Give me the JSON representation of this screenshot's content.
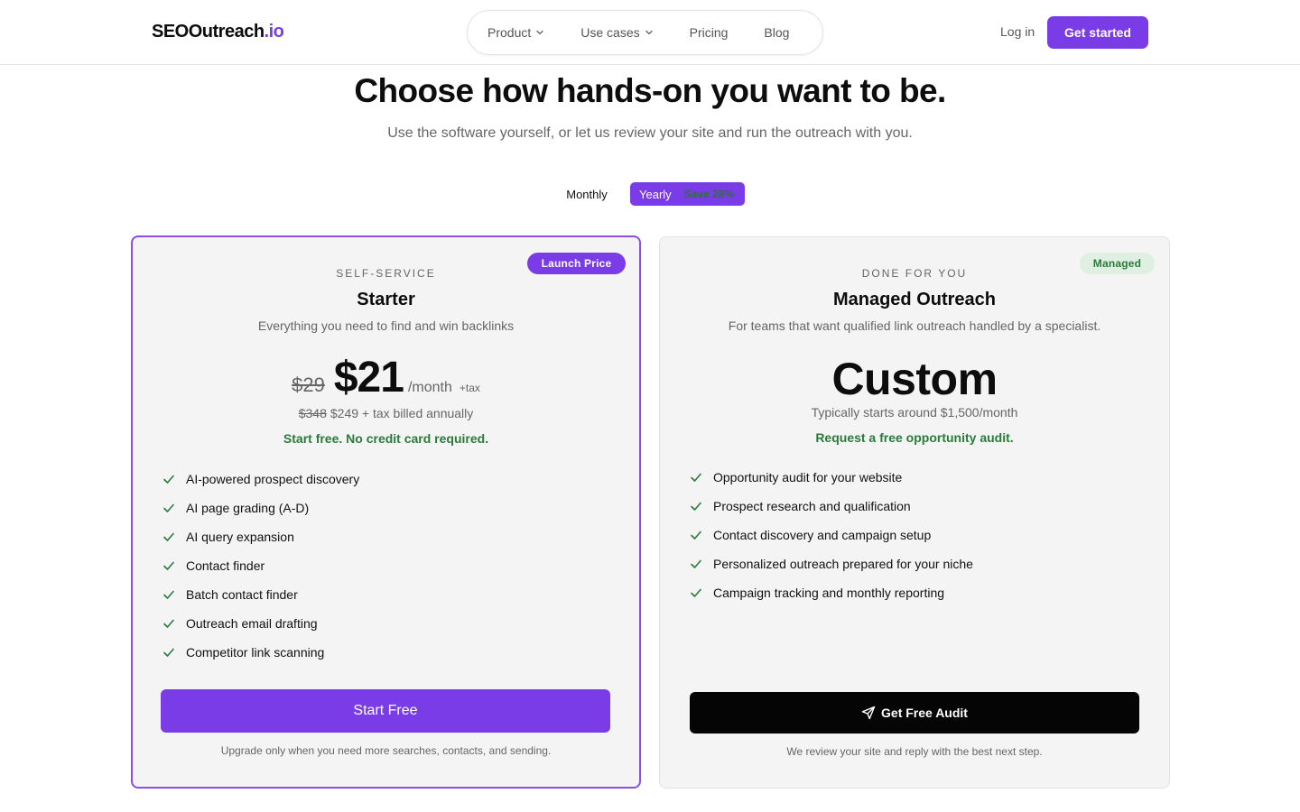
{
  "brand": {
    "name": "SEOOutreach",
    "tld": ".io"
  },
  "nav": {
    "items": [
      {
        "label": "Product",
        "dropdown": true
      },
      {
        "label": "Use cases",
        "dropdown": true
      },
      {
        "label": "Pricing",
        "dropdown": false
      },
      {
        "label": "Blog",
        "dropdown": false
      }
    ],
    "login": "Log in",
    "cta": "Get started"
  },
  "hero": {
    "title": "Choose how hands-on you want to be.",
    "subtitle": "Use the software yourself, or let us review your site and run the outreach with you."
  },
  "billing_toggle": {
    "monthly": "Monthly",
    "yearly": "Yearly",
    "save": "Save 28%",
    "selected": "Yearly"
  },
  "plans": {
    "starter": {
      "badge": "Launch Price",
      "eyebrow": "SELF-SERVICE",
      "name": "Starter",
      "description": "Everything you need to find and win backlinks",
      "old_price": "$29",
      "price": "$21",
      "per": "/month",
      "tax": "+tax",
      "annual_old": "$348",
      "annual": "$249 + tax billed annually",
      "note": "Start free. No credit card required.",
      "features": [
        "AI-powered prospect discovery",
        "AI page grading (A-D)",
        "AI query expansion",
        "Contact finder",
        "Batch contact finder",
        "Outreach email drafting",
        "Competitor link scanning"
      ],
      "cta": "Start Free",
      "footnote": "Upgrade only when you need more searches, contacts, and sending."
    },
    "managed": {
      "badge": "Managed",
      "eyebrow": "DONE FOR YOU",
      "name": "Managed Outreach",
      "description": "For teams that want qualified link outreach handled by a specialist.",
      "price": "Custom",
      "price_note": "Typically starts around $1,500/month",
      "note": "Request a free opportunity audit.",
      "features": [
        "Opportunity audit for your website",
        "Prospect research and qualification",
        "Contact discovery and campaign setup",
        "Personalized outreach prepared for your niche",
        "Campaign tracking and monthly reporting"
      ],
      "cta": "Get Free Audit",
      "cta_icon": "send-icon",
      "footnote": "We review your site and reply with the best next step."
    }
  },
  "colors": {
    "accent": "#7a3ce6",
    "success": "#2a7a3c",
    "card_bg": "#f4f4f4"
  }
}
